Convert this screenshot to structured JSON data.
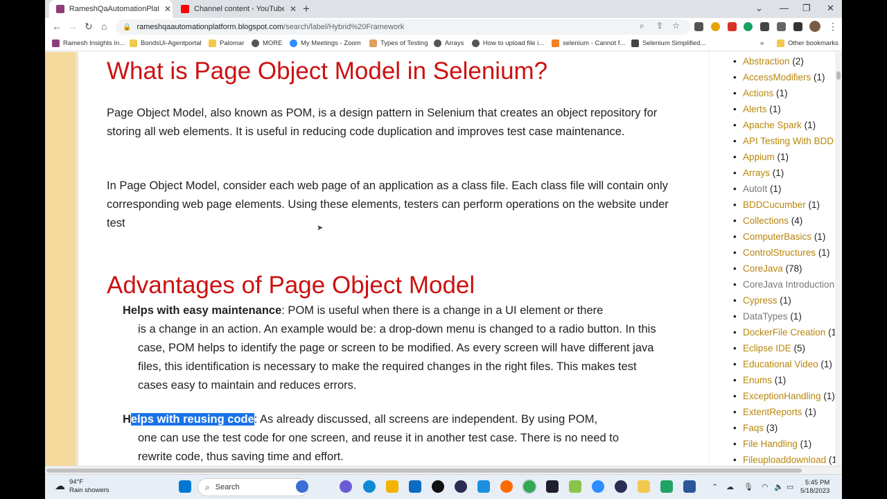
{
  "browser": {
    "tabs": [
      {
        "label": "RameshQaAutomationPlatform",
        "icon": "blogger-icon",
        "color": "#8e3d7a"
      },
      {
        "label": "Channel content - YouTube Studi",
        "icon": "youtube-icon",
        "color": "#ff0000"
      }
    ],
    "window_controls": {
      "dropdown": "⌄",
      "minimize": "—",
      "maximize": "❐",
      "close": "✕"
    },
    "new_tab": "+",
    "url_host": "rameshqaautomationplatform.blogspot.com",
    "url_path": "/search/label/Hybrid%20Framework",
    "bookmarks": [
      {
        "label": "Ramesh Insights In..."
      },
      {
        "label": "BondsUi-Agentportal"
      },
      {
        "label": "Palomar"
      },
      {
        "label": "MORE"
      },
      {
        "label": "My Meetings - Zoom"
      },
      {
        "label": "Types of Testing"
      },
      {
        "label": "Arrays"
      },
      {
        "label": "How to upload file i..."
      },
      {
        "label": "selenium - Cannot f..."
      },
      {
        "label": "Selenium Simplified..."
      }
    ],
    "bookmarks_overflow": "»",
    "other_bookmarks": "Other bookmarks"
  },
  "article": {
    "title1": "What is Page Object Model in Selenium?",
    "para1": "Page Object Model, also known as POM, is a design pattern in Selenium that creates an object repository for storing all web elements. It is useful in reducing code duplication and improves test case maintenance.",
    "para2": "In Page Object Model, consider each web page of an application as a class file. Each class file will contain only corresponding web page elements. Using these elements, testers can perform operations on the website under test",
    "title2": "Advantages of Page Object Model",
    "adv1_bold": "Helps with easy maintenance",
    "adv1_first": ": POM is useful when there is a change in a UI element or there",
    "adv1_rest": "is a change in an action. An example would be: a drop-down menu is changed to a radio button. In this case, POM helps to identify the page or screen to be modified. As every screen will have different java files, this identification is necessary to make the required changes in the right files. This makes test cases easy to maintain and reduces errors.",
    "adv2_bold_a": "H",
    "adv2_bold_b": "elps with reusing code",
    "adv2_first": ": As already discussed, all screens are independent. By using POM,",
    "adv2_rest": "one can use the test code for one screen, and reuse it in another test case. There is no need to rewrite code, thus saving time and effort."
  },
  "sidebar": {
    "labels": [
      {
        "name": "Abstraction",
        "count": "(2)"
      },
      {
        "name": "AccessModifiers",
        "count": "(1)"
      },
      {
        "name": "Actions",
        "count": "(1)"
      },
      {
        "name": "Alerts",
        "count": "(1)"
      },
      {
        "name": "Apache Spark",
        "count": "(1)"
      },
      {
        "name": "API Testing With BDD",
        "count": ""
      },
      {
        "name": "Appium",
        "count": "(1)"
      },
      {
        "name": "Arrays",
        "count": "(1)"
      },
      {
        "name": "AutoIt",
        "count": "(1)",
        "gray": true
      },
      {
        "name": "BDDCucumber",
        "count": "(1)"
      },
      {
        "name": "Collections",
        "count": "(4)"
      },
      {
        "name": "ComputerBasics",
        "count": "(1)"
      },
      {
        "name": "ControlStructures",
        "count": "(1)"
      },
      {
        "name": "CoreJava",
        "count": "(78)"
      },
      {
        "name": "CoreJava Introduction",
        "count": "",
        "gray": true
      },
      {
        "name": "Cypress",
        "count": "(1)"
      },
      {
        "name": "DataTypes",
        "count": "(1)",
        "gray": true
      },
      {
        "name": "DockerFile Creation",
        "count": "(1"
      },
      {
        "name": "Eclipse IDE",
        "count": "(5)"
      },
      {
        "name": "Educational Video",
        "count": "(1)"
      },
      {
        "name": "Enums",
        "count": "(1)"
      },
      {
        "name": "ExceptionHandling",
        "count": "(1)"
      },
      {
        "name": "ExtentReports",
        "count": "(1)"
      },
      {
        "name": "Faqs",
        "count": "(3)"
      },
      {
        "name": "File Handling",
        "count": "(1)"
      },
      {
        "name": "Fileuploaddownload",
        "count": "(1"
      }
    ]
  },
  "taskbar": {
    "weather_temp": "94°F",
    "weather_desc": "Rain showers",
    "search_label": "Search",
    "time": "5:45 PM",
    "date": "5/18/2023"
  }
}
